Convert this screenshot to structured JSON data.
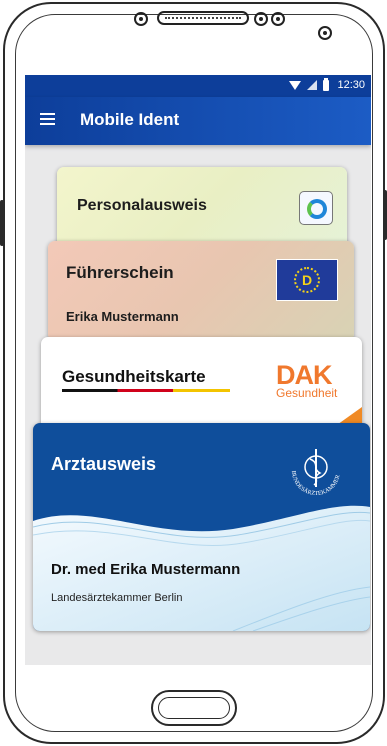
{
  "status_bar": {
    "time": "12:30"
  },
  "app_bar": {
    "title": "Mobile Ident",
    "menu_icon": "hamburger-menu-icon"
  },
  "cards": {
    "personalausweis": {
      "title": "Personalausweis",
      "logo_icon": "ring-logo-icon"
    },
    "fuehrerschein": {
      "title": "Führerschein",
      "holder": "Erika Mustermann",
      "badge": "D"
    },
    "gesundheitskarte": {
      "title": "Gesundheitskarte",
      "insurer": "DAK",
      "insurer_sub": "Gesundheit"
    },
    "arztausweis": {
      "title": "Arztausweis",
      "holder": "Dr. med Erika Mustermann",
      "chamber": "Landesärztekammer Berlin",
      "seal_text": "BUNDESÄRZTEKAMMER"
    }
  },
  "colors": {
    "primary": "#0d3e9a",
    "card_blue": "#0f4e9b",
    "dak_orange": "#f0782d",
    "screen_bg": "#e9e9ea"
  }
}
